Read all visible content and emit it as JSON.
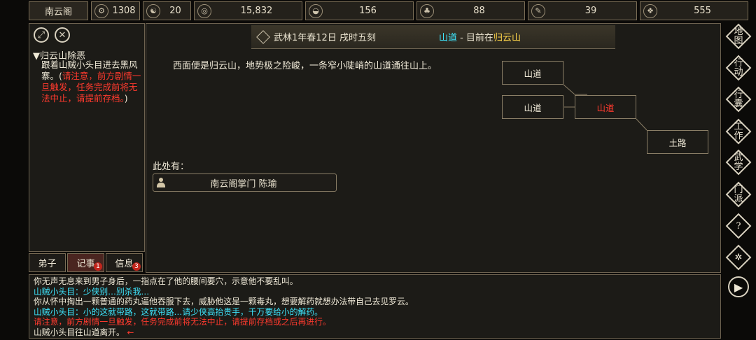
{
  "top_bar": {
    "sect": "南云阁",
    "stats": [
      {
        "icon": "qi-icon",
        "glyph": "⚙",
        "value": "1308"
      },
      {
        "icon": "yin-yang-icon",
        "glyph": "☯",
        "value": "20"
      },
      {
        "icon": "coin-icon",
        "glyph": "◎",
        "value": "15,832"
      },
      {
        "icon": "food-bowl-icon",
        "glyph": "◒",
        "value": "156"
      },
      {
        "icon": "herb-icon",
        "glyph": "♣",
        "value": "88"
      },
      {
        "icon": "scroll-icon",
        "glyph": "✎",
        "value": "39"
      },
      {
        "icon": "ore-icon",
        "glyph": "❖",
        "value": "555"
      }
    ]
  },
  "quest": {
    "title": "▼归云山除恶",
    "body_normal": "跟着山贼小头目进去黑风寨。(",
    "body_warning": "请注意，前方剧情一旦触发，任务完成前将无法中止，请提前存档。",
    "body_end": ")"
  },
  "tabs": [
    {
      "label": "弟子",
      "badge": ""
    },
    {
      "label": "记事",
      "badge": "1"
    },
    {
      "label": "信息",
      "badge": "3"
    }
  ],
  "header": {
    "date": "武林1年春12日 戌时五刻",
    "area": "山道",
    "sep": " - 目前在",
    "place": "归云山"
  },
  "description": "西面便是归云山，地势极之险峻，一条窄小陡峭的山道通往山上。",
  "here_label": "此处有：",
  "npc": "南云阁掌门 陈瑜",
  "map": {
    "rooms": [
      "山道",
      "山道",
      "山道",
      "土路"
    ],
    "current": "山道"
  },
  "log": [
    {
      "text": "你无声无息来到男子身后，一指点在了他的腰间要穴，示意他不要乱叫。",
      "color": "#f0ead8"
    },
    {
      "text": "山贼小头目：少侠别…别杀我…",
      "color": "#3ee7ff"
    },
    {
      "text": "你从怀中掏出一颗普通的药丸逼他吞服下去，威胁他这是一颗毒丸，想要解药就想办法带自己去见罗云。",
      "color": "#f0ead8"
    },
    {
      "text": "山贼小头目：小的这就带路，这就带路…请少侠高抬贵手，千万要给小的解药。",
      "color": "#3ee7ff"
    },
    {
      "text": "请注意，前方剧情一旦触发，任务完成前将无法中止，请提前存档或之后再进行。",
      "color": "#ff3a2e"
    },
    {
      "text": "山贼小头目往山道离开。",
      "color": "#f0ead8",
      "arrow": "←"
    }
  ],
  "right_menu": [
    {
      "name": "map-button",
      "l1": "地",
      "l2": "图"
    },
    {
      "name": "action-button",
      "l1": "行",
      "l2": "动"
    },
    {
      "name": "bag-button",
      "l1": "行",
      "l2": "囊"
    },
    {
      "name": "work-button",
      "l1": "工",
      "l2": "作"
    },
    {
      "name": "martial-button",
      "l1": "武",
      "l2": "学"
    },
    {
      "name": "sect-button",
      "l1": "门",
      "l2": "派"
    }
  ],
  "right_icons": {
    "help": "?",
    "settings": "✲",
    "play": "▶"
  }
}
